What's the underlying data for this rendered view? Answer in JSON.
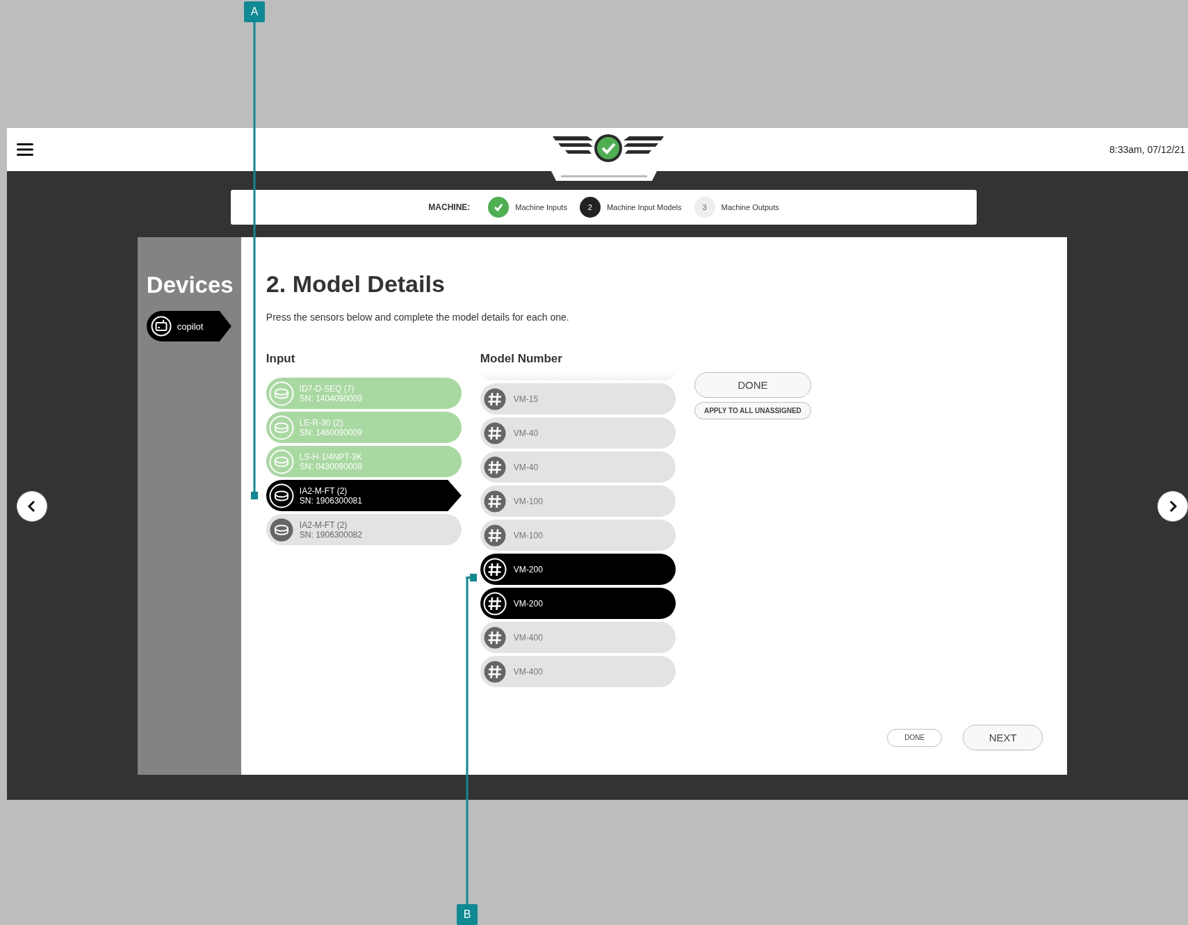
{
  "header": {
    "timestamp": "8:33am, 07/12/21"
  },
  "stepper": {
    "label": "MACHINE:",
    "steps": [
      {
        "label": "Machine Inputs",
        "kind": "complete"
      },
      {
        "number": "2",
        "label": "Machine Input Models",
        "kind": "current"
      },
      {
        "number": "3",
        "label": "Machine Outputs",
        "kind": "upcoming"
      }
    ]
  },
  "sidebar": {
    "title": "Devices",
    "items": [
      {
        "label": "copilot",
        "selected": true
      }
    ]
  },
  "content": {
    "title": "2. Model Details",
    "instructions": "Press the sensors below and complete the model details for each one.",
    "input_column": {
      "heading": "Input",
      "items": [
        {
          "name": "ID7-D-SEQ (7)",
          "serial": "SN: 1404090009",
          "complete": true,
          "selected": false
        },
        {
          "name": "LE-R-30 (2)",
          "serial": "SN: 1460090009",
          "complete": true,
          "selected": false
        },
        {
          "name": "LS-H-1/4NPT-3K",
          "serial": "SN: 0430090009",
          "complete": true,
          "selected": false
        },
        {
          "name": "IA2-M-FT (2)",
          "serial": "SN: 1906300081",
          "complete": false,
          "selected": true
        },
        {
          "name": "IA2-M-FT (2)",
          "serial": "SN: 1906300082",
          "complete": false,
          "selected": false
        }
      ]
    },
    "model_column": {
      "heading": "Model Number",
      "items": [
        {
          "label": "VM-15",
          "selected": false
        },
        {
          "label": "VM-40",
          "selected": false
        },
        {
          "label": "VM-40",
          "selected": false
        },
        {
          "label": "VM-100",
          "selected": false
        },
        {
          "label": "VM-100",
          "selected": false
        },
        {
          "label": "VM-200",
          "selected": true
        },
        {
          "label": "VM-200",
          "selected": true
        },
        {
          "label": "VM-400",
          "selected": false
        },
        {
          "label": "VM-400",
          "selected": false
        }
      ]
    },
    "side_buttons": [
      "DONE",
      "APPLY TO ALL UNASSIGNED"
    ],
    "footer_buttons": [
      "DONE",
      "NEXT"
    ]
  },
  "callouts": [
    {
      "label": "A"
    },
    {
      "label": "B"
    }
  ]
}
